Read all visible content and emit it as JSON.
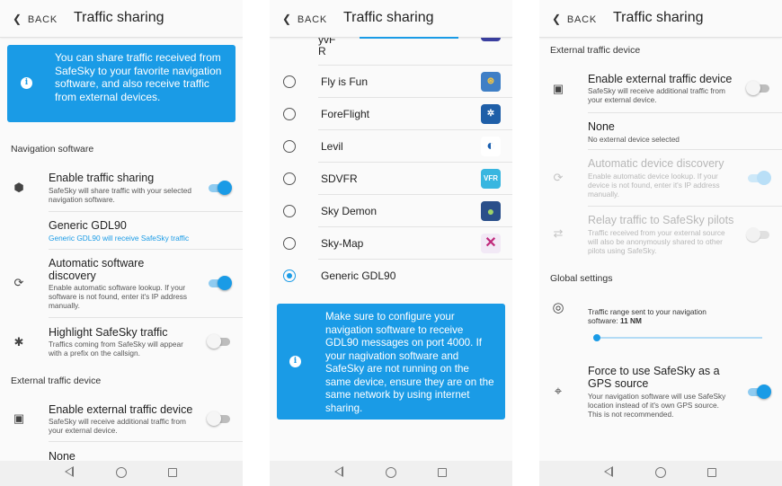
{
  "common": {
    "back_label": "BACK",
    "title": "Traffic sharing"
  },
  "screen1": {
    "info": "You can share traffic received from SafeSky to your favorite navigation software, and also receive traffic from external devices.",
    "section_nav": "Navigation software",
    "enable_sharing": {
      "title": "Enable traffic sharing",
      "subtitle": "SafeSky will share traffic with your selected navigation software.",
      "on": true
    },
    "generic": {
      "title": "Generic GDL90",
      "subtitle": "Generic GDL90 will receive SafeSky traffic"
    },
    "auto_discovery": {
      "title": "Automatic software discovery",
      "subtitle": "Enable automatic software lookup. If your software is not found, enter it's IP address manually.",
      "on": true
    },
    "highlight": {
      "title": "Highlight SafeSky traffic",
      "subtitle": "Traffics coming from SafeSky will appear with a prefix on the callsign.",
      "on": false
    },
    "section_ext": "External traffic device",
    "enable_ext": {
      "title": "Enable external traffic device",
      "subtitle": "SafeSky will receive additional traffic from your external device.",
      "on": false
    },
    "none_label": "None"
  },
  "screen2": {
    "partial_top": "yvF R",
    "apps": [
      {
        "name": "Fly is Fun",
        "logo": "⊛",
        "selected": false
      },
      {
        "name": "ForeFlight",
        "logo": "✲",
        "selected": false
      },
      {
        "name": "Levil",
        "logo": "◐",
        "selected": false
      },
      {
        "name": "SDVFR",
        "logo": "VFR",
        "selected": false
      },
      {
        "name": "Sky Demon",
        "logo": "●",
        "selected": false
      },
      {
        "name": "Sky-Map",
        "logo": "✕",
        "selected": false
      },
      {
        "name": "Generic GDL90",
        "logo": "",
        "selected": true
      }
    ],
    "info": "Make sure to configure your navigation software to receive GDL90 messages on port 4000. If your nagivation software and SafeSky are not running on the same device, ensure they are on the same network by using internet sharing."
  },
  "screen3": {
    "section_ext": "External traffic device",
    "enable_ext": {
      "title": "Enable external traffic device",
      "subtitle": "SafeSky will receive additional traffic from your external device.",
      "on": false
    },
    "none": {
      "title": "None",
      "subtitle": "No external device selected"
    },
    "auto_discovery": {
      "title": "Automatic device discovery",
      "subtitle": "Enable automatic device lookup. If your device is not found, enter it's IP address manually.",
      "on": true
    },
    "relay": {
      "title": "Relay traffic to SafeSky pilots",
      "subtitle": "Traffic received from your external source will also be anonymously shared to other pilots using SafeSky.",
      "on": false
    },
    "section_global": "Global settings",
    "range": {
      "label": "Traffic range sent to your navigation software:",
      "value": "11 NM"
    },
    "force_gps": {
      "title": "Force to use SafeSky as a GPS source",
      "subtitle": "Your navigation software will use SafeSky location instead of it's own GPS source. This is not recommended.",
      "on": true
    }
  }
}
